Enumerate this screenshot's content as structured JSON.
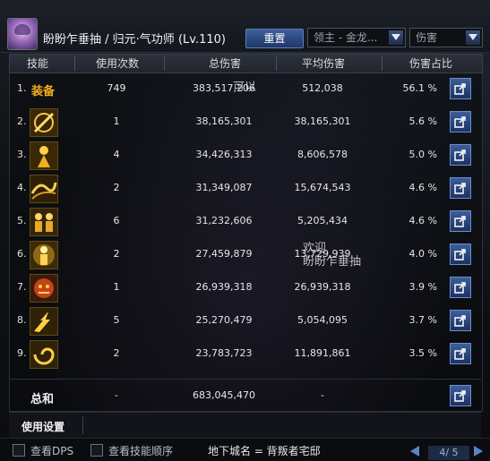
{
  "character": {
    "name": "盼盼乍垂抽",
    "class_path": "归元·气功师",
    "level_label": "(Lv.110)"
  },
  "toolbar": {
    "reset_label": "重置",
    "target_select": "领主 - 金龙...",
    "mode_select": "伤害"
  },
  "table": {
    "columns": [
      "技能",
      "使用次数",
      "总伤害",
      "平均伤害",
      "伤害占比"
    ],
    "rows": [
      {
        "index": "1.",
        "skill": "装备",
        "uses": "749",
        "total": "383,517,206",
        "avg": "512,038",
        "pct": "56.1 %"
      },
      {
        "index": "2.",
        "skill": "",
        "uses": "1",
        "total": "38,165,301",
        "avg": "38,165,301",
        "pct": "5.6 %"
      },
      {
        "index": "3.",
        "skill": "",
        "uses": "4",
        "total": "34,426,313",
        "avg": "8,606,578",
        "pct": "5.0 %"
      },
      {
        "index": "4.",
        "skill": "",
        "uses": "2",
        "total": "31,349,087",
        "avg": "15,674,543",
        "pct": "4.6 %"
      },
      {
        "index": "5.",
        "skill": "",
        "uses": "6",
        "total": "31,232,606",
        "avg": "5,205,434",
        "pct": "4.6 %"
      },
      {
        "index": "6.",
        "skill": "",
        "uses": "2",
        "total": "27,459,879",
        "avg": "13,729,939",
        "pct": "4.0 %"
      },
      {
        "index": "7.",
        "skill": "",
        "uses": "1",
        "total": "26,939,318",
        "avg": "26,939,318",
        "pct": "3.9 %"
      },
      {
        "index": "8.",
        "skill": "",
        "uses": "5",
        "total": "25,270,479",
        "avg": "5,054,095",
        "pct": "3.7 %"
      },
      {
        "index": "9.",
        "skill": "",
        "uses": "2",
        "total": "23,783,723",
        "avg": "11,891,861",
        "pct": "3.5 %"
      }
    ],
    "icons": [
      "equipment-label",
      "palm-strike-icon",
      "fist-burst-icon",
      "dragon-wave-icon",
      "multi-figure-icon",
      "glow-figure-icon",
      "tiger-mask-icon",
      "lightning-burst-icon",
      "swirl-burst-icon"
    ],
    "total_row": {
      "label": "总和",
      "uses": "-",
      "total": "683,045,470",
      "avg": "-"
    }
  },
  "settings_label": "使用设置",
  "bottom_bar": {
    "check_dps_label": "查看DPS",
    "check_order_label": "查看技能顺序",
    "dungeon_label": "地下城名 = 背叛者宅邸",
    "page": "4/ 5"
  },
  "background_text": {
    "line1": "可以",
    "line2": "盼盼乍垂抽",
    "line3": "欢迎"
  },
  "colors": {
    "accent_blue": "#3d5f9c",
    "equipment_gold": "#f2b01e"
  }
}
